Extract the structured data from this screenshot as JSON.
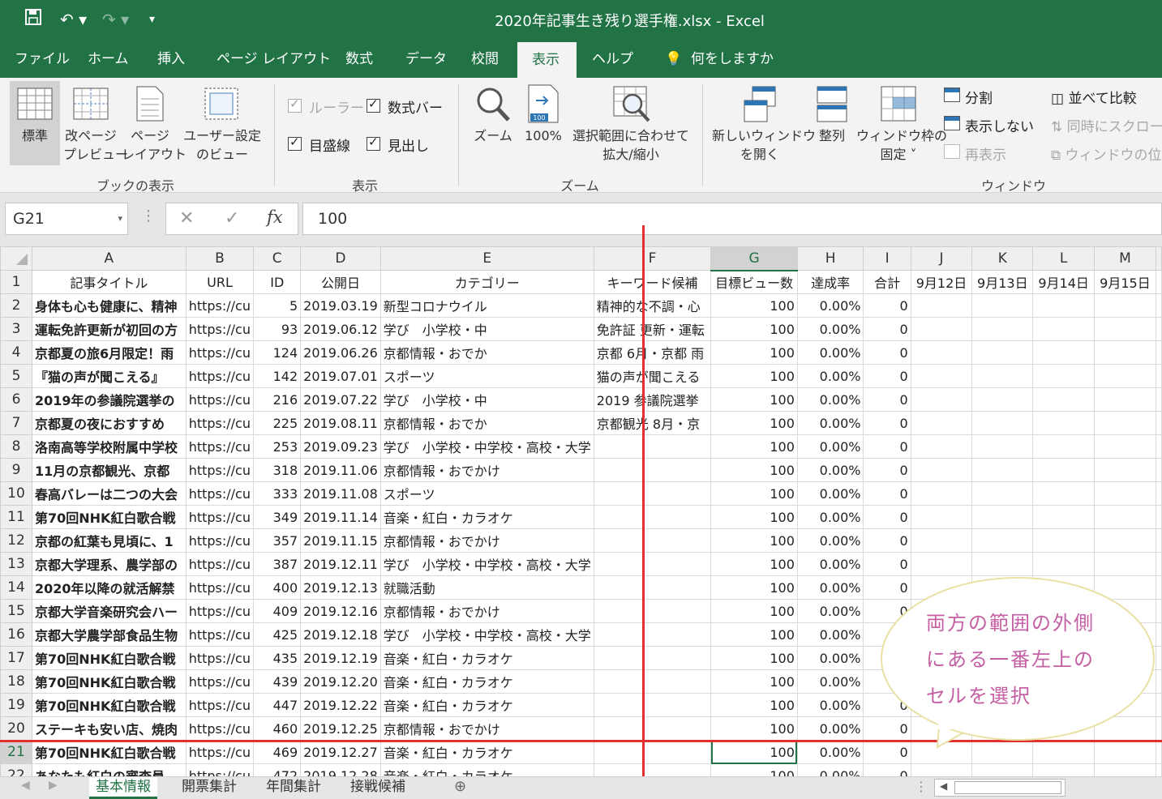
{
  "window": {
    "title": "2020年記事生き残り選手権.xlsx  -  Excel"
  },
  "menu": {
    "tabs": [
      "ファイル",
      "ホーム",
      "挿入",
      "ページ レイアウト",
      "数式",
      "データ",
      "校閲",
      "表示",
      "ヘルプ"
    ],
    "active": "表示",
    "tell_me": "何をしますか"
  },
  "ribbon": {
    "book_view": {
      "normal": "標準",
      "page_break": "改ページ\nプレビュー",
      "page_layout": "ページ\nレイアウト",
      "custom": "ユーザー設定\nのビュー",
      "group": "ブックの表示"
    },
    "show": {
      "ruler": "ルーラー",
      "formula_bar": "数式バー",
      "gridlines": "目盛線",
      "headings": "見出し",
      "group": "表示"
    },
    "zoom": {
      "zoom": "ズーム",
      "hundred": "100%",
      "fit": "選択範囲に合わせて\n拡大/縮小",
      "group": "ズーム"
    },
    "window": {
      "new_window": "新しいウィンドウ\nを開く",
      "arrange": "整列",
      "freeze": "ウィンドウ枠の\n固定 ˅",
      "split": "分割",
      "hide": "表示しない",
      "unhide": "再表示",
      "side_by_side": "並べて比較",
      "sync_scroll": "同時にスクロール",
      "reset_pos": "ウィンドウの位置",
      "group": "ウィンドウ"
    }
  },
  "formula_bar": {
    "name_box": "G21",
    "value": "100"
  },
  "columns": [
    "A",
    "B",
    "C",
    "D",
    "E",
    "F",
    "G",
    "H",
    "I",
    "J",
    "K",
    "L",
    "M"
  ],
  "header_row": [
    "記事タイトル",
    "URL",
    "ID",
    "公開日",
    "カテゴリー",
    "キーワード候補",
    "目標ビュー数",
    "達成率",
    "合計",
    "9月12日",
    "9月13日",
    "9月14日",
    "9月15日"
  ],
  "rows": [
    {
      "n": "2",
      "a": "身体も心も健康に、精神",
      "b": "https://cu",
      "c": "5",
      "d": "2019.03.19",
      "e": "新型コロナウイル",
      "f": "精神的な不調・心",
      "g": "100",
      "h": "0.00%",
      "i": "0"
    },
    {
      "n": "3",
      "a": "運転免許更新が初回の方",
      "b": "https://cu",
      "c": "93",
      "d": "2019.06.12",
      "e": "学び　小学校・中",
      "f": "免許証 更新・運転",
      "g": "100",
      "h": "0.00%",
      "i": "0"
    },
    {
      "n": "4",
      "a": "京都夏の旅6月限定！雨",
      "b": "https://cu",
      "c": "124",
      "d": "2019.06.26",
      "e": "京都情報・おでか",
      "f": "京都 6月・京都 雨",
      "g": "100",
      "h": "0.00%",
      "i": "0"
    },
    {
      "n": "5",
      "a": "『猫の声が聞こえる』",
      "b": "https://cu",
      "c": "142",
      "d": "2019.07.01",
      "e": "スポーツ",
      "f": "猫の声が聞こえる",
      "g": "100",
      "h": "0.00%",
      "i": "0"
    },
    {
      "n": "6",
      "a": "2019年の参議院選挙の",
      "b": "https://cu",
      "c": "216",
      "d": "2019.07.22",
      "e": "学び　小学校・中",
      "f": "2019 参議院選挙 ",
      "g": "100",
      "h": "0.00%",
      "i": "0"
    },
    {
      "n": "7",
      "a": "京都夏の夜におすすめ",
      "b": "https://cu",
      "c": "225",
      "d": "2019.08.11",
      "e": "京都情報・おでか",
      "f": "京都観光 8月・京",
      "g": "100",
      "h": "0.00%",
      "i": "0"
    },
    {
      "n": "8",
      "a": "洛南高等学校附属中学校",
      "b": "https://cu",
      "c": "253",
      "d": "2019.09.23",
      "e": "学び　小学校・中学校・高校・大学",
      "f": "",
      "g": "100",
      "h": "0.00%",
      "i": "0"
    },
    {
      "n": "9",
      "a": "11月の京都観光、京都",
      "b": "https://cu",
      "c": "318",
      "d": "2019.11.06",
      "e": "京都情報・おでかけ",
      "f": "",
      "g": "100",
      "h": "0.00%",
      "i": "0"
    },
    {
      "n": "10",
      "a": "春高バレーは二つの大会",
      "b": "https://cu",
      "c": "333",
      "d": "2019.11.08",
      "e": "スポーツ",
      "f": "",
      "g": "100",
      "h": "0.00%",
      "i": "0"
    },
    {
      "n": "11",
      "a": "第70回NHK紅白歌合戦",
      "b": "https://cu",
      "c": "349",
      "d": "2019.11.14",
      "e": "音楽・紅白・カラオケ",
      "f": "",
      "g": "100",
      "h": "0.00%",
      "i": "0"
    },
    {
      "n": "12",
      "a": "京都の紅葉も見頃に、1",
      "b": "https://cu",
      "c": "357",
      "d": "2019.11.15",
      "e": "京都情報・おでかけ",
      "f": "",
      "g": "100",
      "h": "0.00%",
      "i": "0"
    },
    {
      "n": "13",
      "a": "京都大学理系、農学部の",
      "b": "https://cu",
      "c": "387",
      "d": "2019.12.11",
      "e": "学び　小学校・中学校・高校・大学",
      "f": "",
      "g": "100",
      "h": "0.00%",
      "i": "0"
    },
    {
      "n": "14",
      "a": "2020年以降の就活解禁",
      "b": "https://cu",
      "c": "400",
      "d": "2019.12.13",
      "e": "就職活動",
      "f": "",
      "g": "100",
      "h": "0.00%",
      "i": "0"
    },
    {
      "n": "15",
      "a": "京都大学音楽研究会ハー",
      "b": "https://cu",
      "c": "409",
      "d": "2019.12.16",
      "e": "京都情報・おでかけ",
      "f": "",
      "g": "100",
      "h": "0.00%",
      "i": "0"
    },
    {
      "n": "16",
      "a": "京都大学農学部食品生物",
      "b": "https://cu",
      "c": "425",
      "d": "2019.12.18",
      "e": "学び　小学校・中学校・高校・大学",
      "f": "",
      "g": "100",
      "h": "0.00%",
      "i": "0"
    },
    {
      "n": "17",
      "a": "第70回NHK紅白歌合戦",
      "b": "https://cu",
      "c": "435",
      "d": "2019.12.19",
      "e": "音楽・紅白・カラオケ",
      "f": "",
      "g": "100",
      "h": "0.00%",
      "i": "0"
    },
    {
      "n": "18",
      "a": "第70回NHK紅白歌合戦",
      "b": "https://cu",
      "c": "439",
      "d": "2019.12.20",
      "e": "音楽・紅白・カラオケ",
      "f": "",
      "g": "100",
      "h": "0.00%",
      "i": "0"
    },
    {
      "n": "19",
      "a": "第70回NHK紅白歌合戦",
      "b": "https://cu",
      "c": "447",
      "d": "2019.12.22",
      "e": "音楽・紅白・カラオケ",
      "f": "",
      "g": "100",
      "h": "0.00%",
      "i": "0"
    },
    {
      "n": "20",
      "a": "ステーキも安い店、焼肉",
      "b": "https://cu",
      "c": "460",
      "d": "2019.12.25",
      "e": "京都情報・おでかけ",
      "f": "",
      "g": "100",
      "h": "0.00%",
      "i": "0"
    },
    {
      "n": "21",
      "a": "第70回NHK紅白歌合戦",
      "b": "https://cu",
      "c": "469",
      "d": "2019.12.27",
      "e": "音楽・紅白・カラオケ",
      "f": "",
      "g": "100",
      "h": "0.00%",
      "i": "0"
    },
    {
      "n": "22",
      "a": "あなたも紅白の審査員",
      "b": "https://cu",
      "c": "472",
      "d": "2019.12.28",
      "e": "音楽・紅白・カラオケ",
      "f": "",
      "g": "100",
      "h": "0.00%",
      "i": "0"
    }
  ],
  "sheet_tabs": [
    "基本情報",
    "開票集計",
    "年間集計",
    "接戦候補"
  ],
  "active_sheet": "基本情報",
  "callout": {
    "lines": [
      "両方の範囲の外側",
      "にある一番左上の",
      "セルを選択"
    ]
  },
  "colors": {
    "excel_green": "#217346",
    "annotation_red": "#e03030",
    "callout_text": "#c45fa4"
  }
}
